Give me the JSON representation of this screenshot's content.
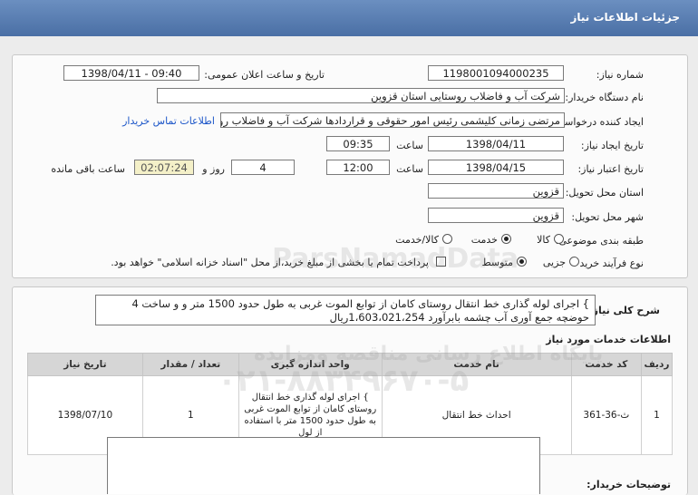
{
  "header": {
    "title": "جزئیات اطلاعات نیاز"
  },
  "form": {
    "need_number_label": "شماره نیاز:",
    "need_number": "1198001094000235",
    "announce_label": "تاریخ و ساعت اعلان عمومی:",
    "announce_value": "1398/04/11 - 09:40",
    "buyer_label": "نام دستگاه خریدار:",
    "buyer_value": "شرکت آب و فاضلاب روستایی استان قزوین",
    "creator_label": "ایجاد کننده درخواست:",
    "creator_value": "مرتضی زمانی کلیشمی رئیس امور حقوقی و قراردادها شرکت آب و فاضلاب روستایی",
    "contact_link": "اطلاعات تماس خریدار",
    "created_date_label": "تاریخ ایجاد نیاز:",
    "created_date": "1398/04/11",
    "time_label": "ساعت",
    "created_time": "09:35",
    "validity_label": "تاریخ اعتبار نیاز:",
    "validity_date": "1398/04/15",
    "validity_time": "12:00",
    "day_and_label": "روز و",
    "days_value": "4",
    "remaining_value": "02:07:24",
    "remaining_label": "ساعت باقی مانده",
    "province_label": "استان محل تحویل:",
    "province_value": "قزوین",
    "city_label": "شهر محل تحویل:",
    "city_value": "قزوین",
    "category_label": "طبقه بندی موضوعی:",
    "category_options": [
      "کالا",
      "خدمت",
      "کالا/خدمت"
    ],
    "process_label": "نوع فرآیند خرید :",
    "process_options": [
      "جزیی",
      "متوسط"
    ],
    "payment_note": "پرداخت تمام یا بخشی از مبلغ خرید،از محل \"اسناد خزانه اسلامی\" خواهد بود."
  },
  "description": {
    "label": "شرح کلی نیاز:",
    "text": "} اجرای لوله گذاری خط انتقال روستای کامان از توابع الموت غربی به طول حدود 1500 متر و و ساخت 4 حوضچه جمع آوری آب چشمه بابرآورد 1،603،021،254ریال"
  },
  "services": {
    "section_title": "اطلاعات خدمات مورد نیاز",
    "columns": [
      "ردیف",
      "کد خدمت",
      "نام خدمت",
      "واحد اندازه گیری",
      "تعداد / مقدار",
      "تاریخ نیاز"
    ],
    "rows": [
      {
        "row": "1",
        "code": "ث-36-361",
        "name": "احداث خط انتقال",
        "unit": "} اجرای لوله گذاری خط انتقال روستای کامان از توابع الموت غربی به طول حدود 1500 متر با استفاده از لول",
        "qty": "1",
        "date": "1398/07/10"
      }
    ]
  },
  "buyer_notes": {
    "label": "توضیحات خریدار:"
  },
  "watermarks": {
    "en": "ParsNamadData",
    "fa": "پایگاه اطلاع رسانی مناقصه ومزایده",
    "phone": "۰۲۱-۸۸۳۴۹۶۷۰-۵"
  }
}
